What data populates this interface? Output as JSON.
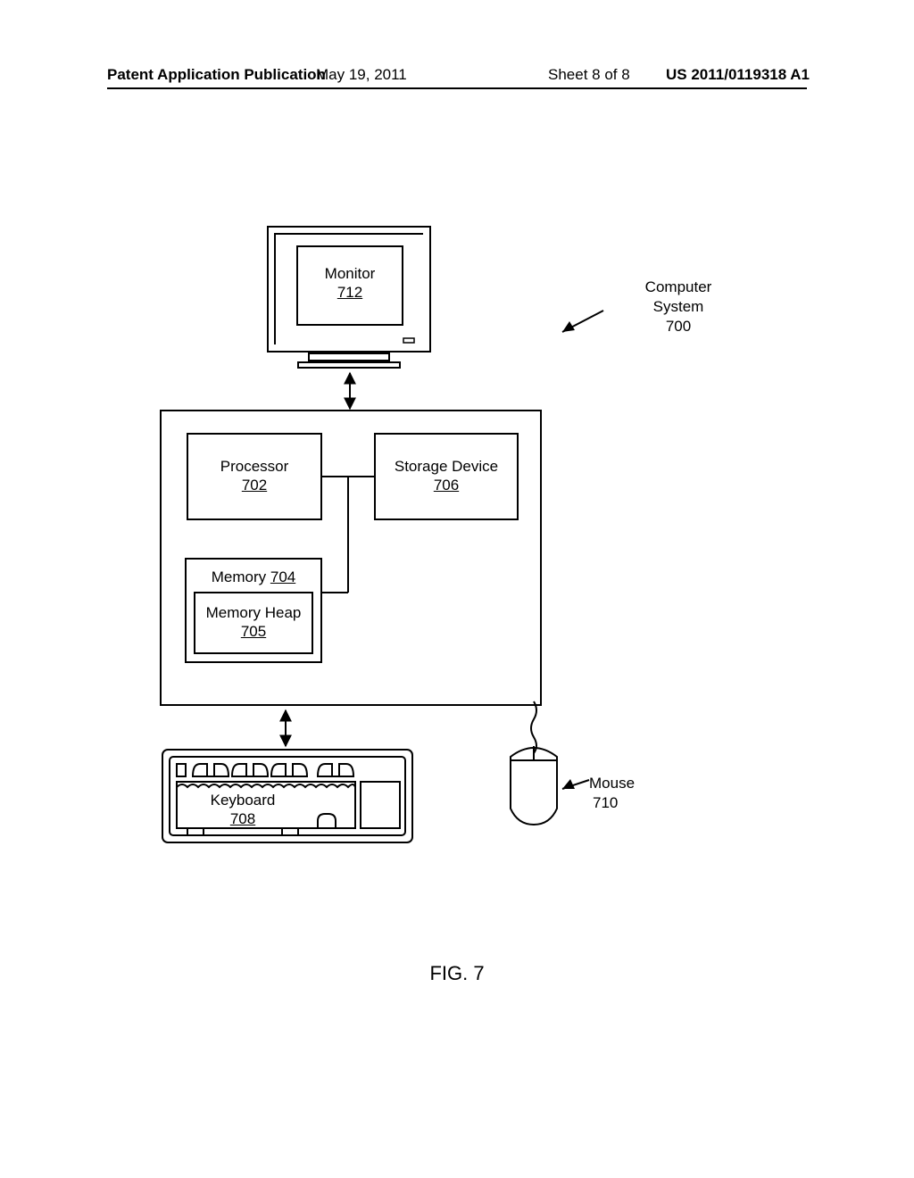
{
  "header": {
    "left": "Patent Application Publication",
    "date": "May 19, 2011",
    "sheet": "Sheet 8 of 8",
    "pubnum": "US 2011/0119318 A1"
  },
  "figure_label": "FIG. 7",
  "system": {
    "label": "Computer System",
    "refnum": "700"
  },
  "monitor": {
    "label": "Monitor",
    "refnum": "712"
  },
  "processor": {
    "label": "Processor",
    "refnum": "702"
  },
  "storage": {
    "label": "Storage Device",
    "refnum": "706"
  },
  "memory": {
    "label": "Memory",
    "refnum": "704"
  },
  "heap": {
    "label": "Memory Heap",
    "refnum": "705"
  },
  "keyboard": {
    "label": "Keyboard",
    "refnum": "708"
  },
  "mouse": {
    "label": "Mouse",
    "refnum": "710"
  }
}
